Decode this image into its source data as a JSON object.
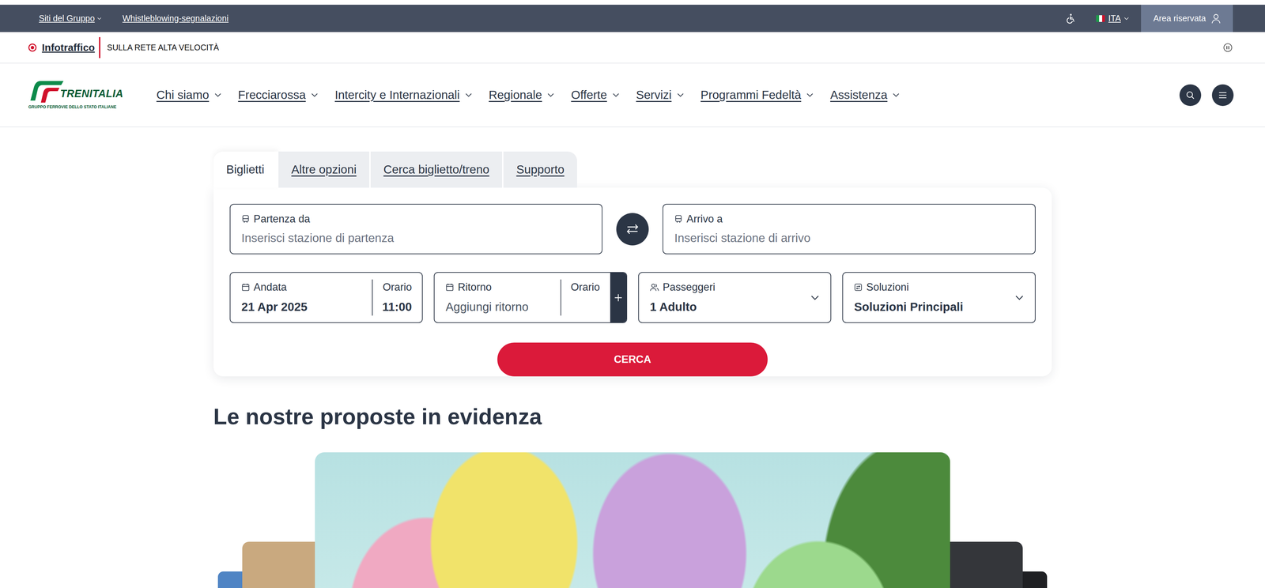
{
  "top_bar": {
    "links": [
      {
        "label": "Siti del Gruppo",
        "dropdown": true
      },
      {
        "label": "Whistleblowing-segnalazioni",
        "dropdown": false
      }
    ],
    "language": "ITA",
    "account": "Area riservata"
  },
  "infotraffico": {
    "label": "Infotraffico",
    "message": "SULLA RETE ALTA VELOCITÀ"
  },
  "logo": {
    "name": "TRENITALIA",
    "subtitle": "GRUPPO FERROVIE DELLO STATO ITALIANE"
  },
  "nav": {
    "items": [
      "Chi siamo",
      "Frecciarossa",
      "Intercity e Internazionali",
      "Regionale",
      "Offerte",
      "Servizi",
      "Programmi Fedeltà",
      "Assistenza"
    ]
  },
  "booking": {
    "tabs": [
      {
        "label": "Biglietti",
        "selected": true
      },
      {
        "label": "Altre opzioni",
        "selected": false
      },
      {
        "label": "Cerca biglietto/treno",
        "selected": false
      },
      {
        "label": "Supporto",
        "selected": false
      }
    ],
    "departure": {
      "label": "Partenza da",
      "placeholder": "Inserisci stazione di partenza"
    },
    "arrival": {
      "label": "Arrivo a",
      "placeholder": "Inserisci stazione di arrivo"
    },
    "outbound": {
      "label": "Andata",
      "value": "21 Apr 2025",
      "time_label": "Orario",
      "time": "11:00"
    },
    "return": {
      "label": "Ritorno",
      "placeholder": "Aggiungi ritorno",
      "time_label": "Orario"
    },
    "passengers": {
      "label": "Passeggeri",
      "value": "1 Adulto"
    },
    "solutions": {
      "label": "Soluzioni",
      "value": "Soluzioni Principali"
    },
    "search_button": "CERCA"
  },
  "featured": {
    "title": "Le nostre proposte in evidenza"
  }
}
